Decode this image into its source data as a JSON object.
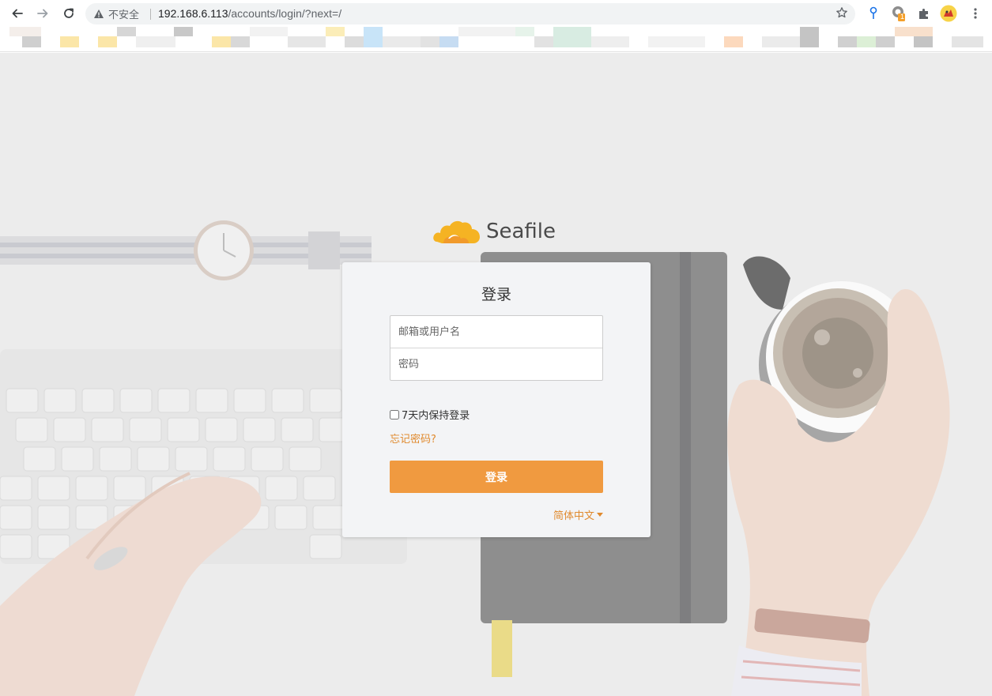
{
  "browser": {
    "security_label": "不安全",
    "url_host": "192.168.6.113",
    "url_path": "/accounts/login/?next=/",
    "extension_badge": "1"
  },
  "login": {
    "logo_text": "Seafile",
    "title": "登录",
    "username_placeholder": "邮箱或用户名",
    "password_placeholder": "密码",
    "remember_label": "7天内保持登录",
    "forgot_label": "忘记密码?",
    "submit_label": "登录",
    "language_label": "简体中文"
  },
  "colors": {
    "accent": "#f09a40",
    "link": "#e08a2e",
    "panel": "#f3f4f6",
    "page_background": "#ececec"
  }
}
